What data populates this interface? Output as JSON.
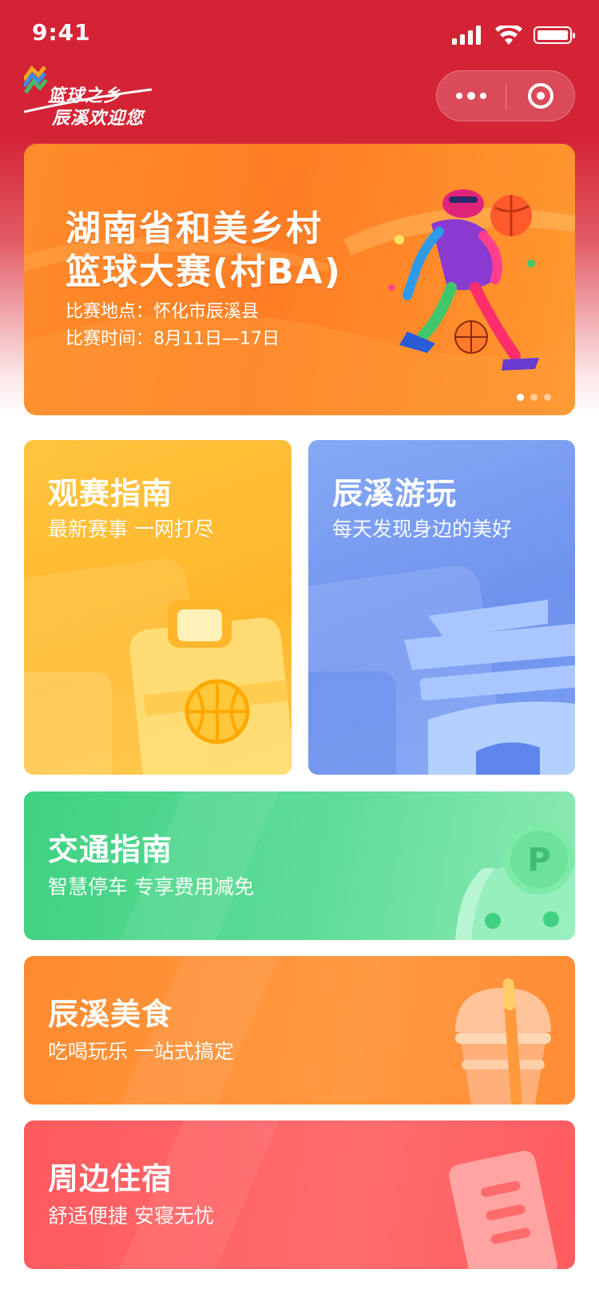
{
  "status_bar": {
    "time": "9:41"
  },
  "logo": {
    "line1": "篮球之乡",
    "line2": "辰溪欢迎您"
  },
  "banner": {
    "title_line1": "湖南省和美乡村",
    "title_line2": "篮球大赛(村BA)",
    "location": "比赛地点：怀化市辰溪县",
    "time": "比赛时间：8月11日—17日",
    "slide_count": 3,
    "active_slide": 1
  },
  "cards": {
    "guide": {
      "title": "观赛指南",
      "subtitle": "最新赛事 一网打尽"
    },
    "tour": {
      "title": "辰溪游玩",
      "subtitle": "每天发现身边的美好"
    },
    "traffic": {
      "title": "交通指南",
      "subtitle": "智慧停车  专享费用减免",
      "badge": "P"
    },
    "food": {
      "title": "辰溪美食",
      "subtitle": "吃喝玩乐 一站式搞定"
    },
    "hotel": {
      "title": "周边住宿",
      "subtitle": "舒适便捷 安寝无忧"
    }
  },
  "colors": {
    "header_red": "#d42335",
    "guide_yellow": "#ffb62a",
    "tour_blue": "#6f92ee",
    "traffic_green": "#3fd182",
    "food_orange": "#ff8a2e",
    "hotel_red": "#ff5a5e"
  },
  "icons": [
    "signal-icon",
    "wifi-icon",
    "battery-icon",
    "more-dots-icon",
    "close-target-icon",
    "basketball-icon",
    "building-icon",
    "parking-car-icon",
    "drink-cup-icon",
    "hotel-card-icon"
  ]
}
